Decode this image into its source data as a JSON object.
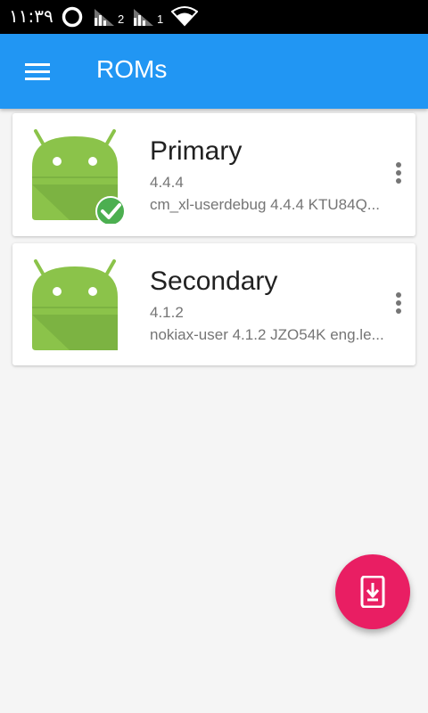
{
  "status_bar": {
    "time": "۱۱:۳۹",
    "sim1_label": "2",
    "sim2_label": "1",
    "icons": [
      "sync-icon",
      "signal-icon",
      "signal-icon",
      "wifi-icon"
    ]
  },
  "app_bar": {
    "title": "ROMs",
    "menu_icon": "menu-icon"
  },
  "roms": [
    {
      "name": "Primary",
      "version": "4.4.4",
      "build": "cm_xl-userdebug 4.4.4 KTU84Q...",
      "active": true
    },
    {
      "name": "Secondary",
      "version": "4.1.2",
      "build": "nokiax-user 4.1.2 JZO54K eng.le...",
      "active": false
    }
  ],
  "fab": {
    "icon": "install-to-device-icon"
  },
  "colors": {
    "primary": "#2196f3",
    "accent": "#e91e63",
    "android_green": "#8bc34a",
    "check_green": "#4caf50"
  }
}
